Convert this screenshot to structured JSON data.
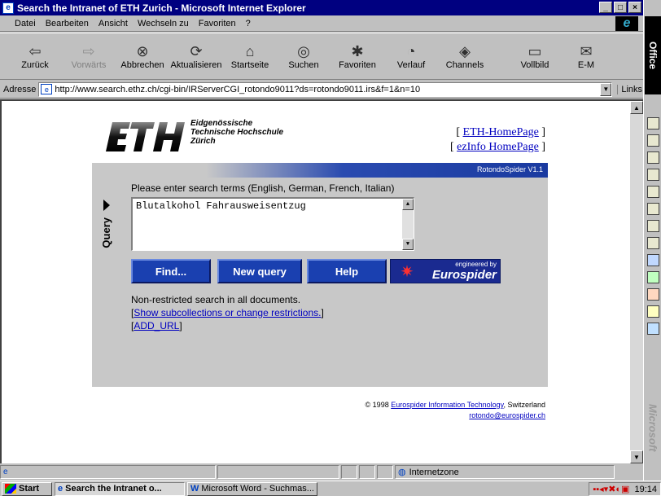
{
  "window": {
    "title": "Search the Intranet of ETH Zurich - Microsoft Internet Explorer",
    "btn_min": "_",
    "btn_max": "□",
    "btn_close": "×"
  },
  "menu": [
    "Datei",
    "Bearbeiten",
    "Ansicht",
    "Wechseln zu",
    "Favoriten",
    "?"
  ],
  "toolbar": {
    "back": "Zurück",
    "forward": "Vorwärts",
    "stop": "Abbrechen",
    "refresh": "Aktualisieren",
    "home": "Startseite",
    "search": "Suchen",
    "favorites": "Favoriten",
    "history": "Verlauf",
    "channels": "Channels",
    "fullscreen": "Vollbild",
    "mail": "E-M"
  },
  "address": {
    "label": "Adresse",
    "url": "http://www.search.ethz.ch/cgi-bin/IRServerCGI_rotondo9011?ds=rotondo9011.irs&f=1&n=10",
    "links": "Links"
  },
  "eth": {
    "name_line1": "Eidgenössische",
    "name_line2": "Technische Hochschule",
    "name_line3": "Zürich",
    "logo_text": "ETH",
    "link_home": "ETH-HomePage",
    "link_ezinfo": "ezInfo HomePage"
  },
  "search": {
    "version": "RotondoSpider V1.1",
    "tab_label": "Query",
    "prompt": "Please enter search terms (English, German, French, Italian)",
    "query_value": "Blutalkohol Fahrausweisentzug",
    "btn_find": "Find...",
    "btn_new": "New query",
    "btn_help": "Help",
    "engineered_by": "engineered by",
    "brand": "Eurospider",
    "status_text": "Non-restricted search in all documents.",
    "link_subcollections": "Show subcollections or change restrictions.",
    "link_add_url": "ADD_URL"
  },
  "footer": {
    "copyright_prefix": "© 1998",
    "company_link": "Eurospider Information Technology",
    "country": ", Switzerland",
    "email": "rotondo@eurospider.ch"
  },
  "statusbar": {
    "zone": "Internetzone"
  },
  "officebar": {
    "label": "Office",
    "brand": "Microsoft"
  },
  "taskbar": {
    "start": "Start",
    "task1": "Search the Intranet o...",
    "task2": "Microsoft Word - Suchmas...",
    "clock": "19:14"
  }
}
